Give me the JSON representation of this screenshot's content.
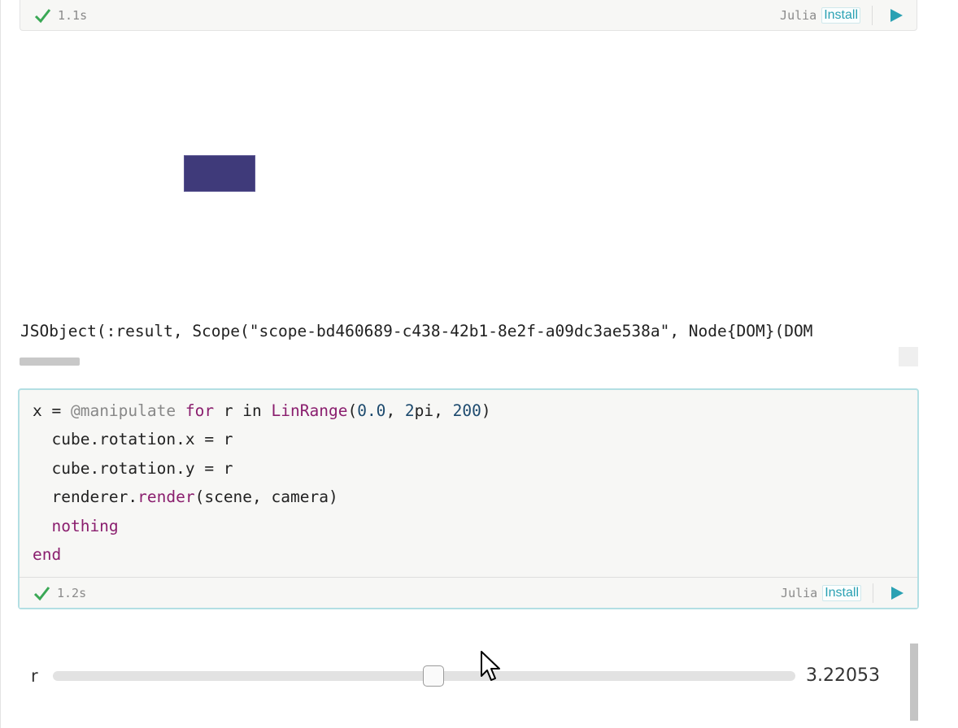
{
  "top_cell": {
    "status_icon": "check-icon",
    "time": "1.1s",
    "language": "Julia",
    "install_label": "Install"
  },
  "output": {
    "jsobject_text": "JSObject(:result, Scope(\"scope-bd460689-c438-42b1-8e2f-a09dc3ae538a\", Node{DOM}(DOM",
    "scene_colors": {
      "cube": "#3f3a7a"
    }
  },
  "code_cell": {
    "lines": {
      "l1": {
        "x": "x = ",
        "macro": "@manipulate",
        "for": " for",
        "mid": " r in ",
        "fn": "LinRange",
        "open": "(",
        "n1": "0.0",
        "c1": ", ",
        "n2": "2",
        "pi": "pi, ",
        "n3": "200",
        "close": ")"
      },
      "l2": "  cube.rotation.x = r",
      "l3": "  cube.rotation.y = r",
      "l4": {
        "a": "  renderer.",
        "fn": "render",
        "b": "(scene, camera)"
      },
      "l5": "  nothing",
      "l6": "end"
    },
    "status_icon": "check-icon",
    "time": "1.2s",
    "language": "Julia",
    "install_label": "Install"
  },
  "slider": {
    "label": "r",
    "value": "3.22053",
    "min": 0.0,
    "max": 6.283185307179586,
    "fraction": 0.5125
  },
  "colors": {
    "accent": "#2aa1b3",
    "check": "#3aa855",
    "keyword": "#8a1e6e",
    "number": "#1d4a6e"
  }
}
